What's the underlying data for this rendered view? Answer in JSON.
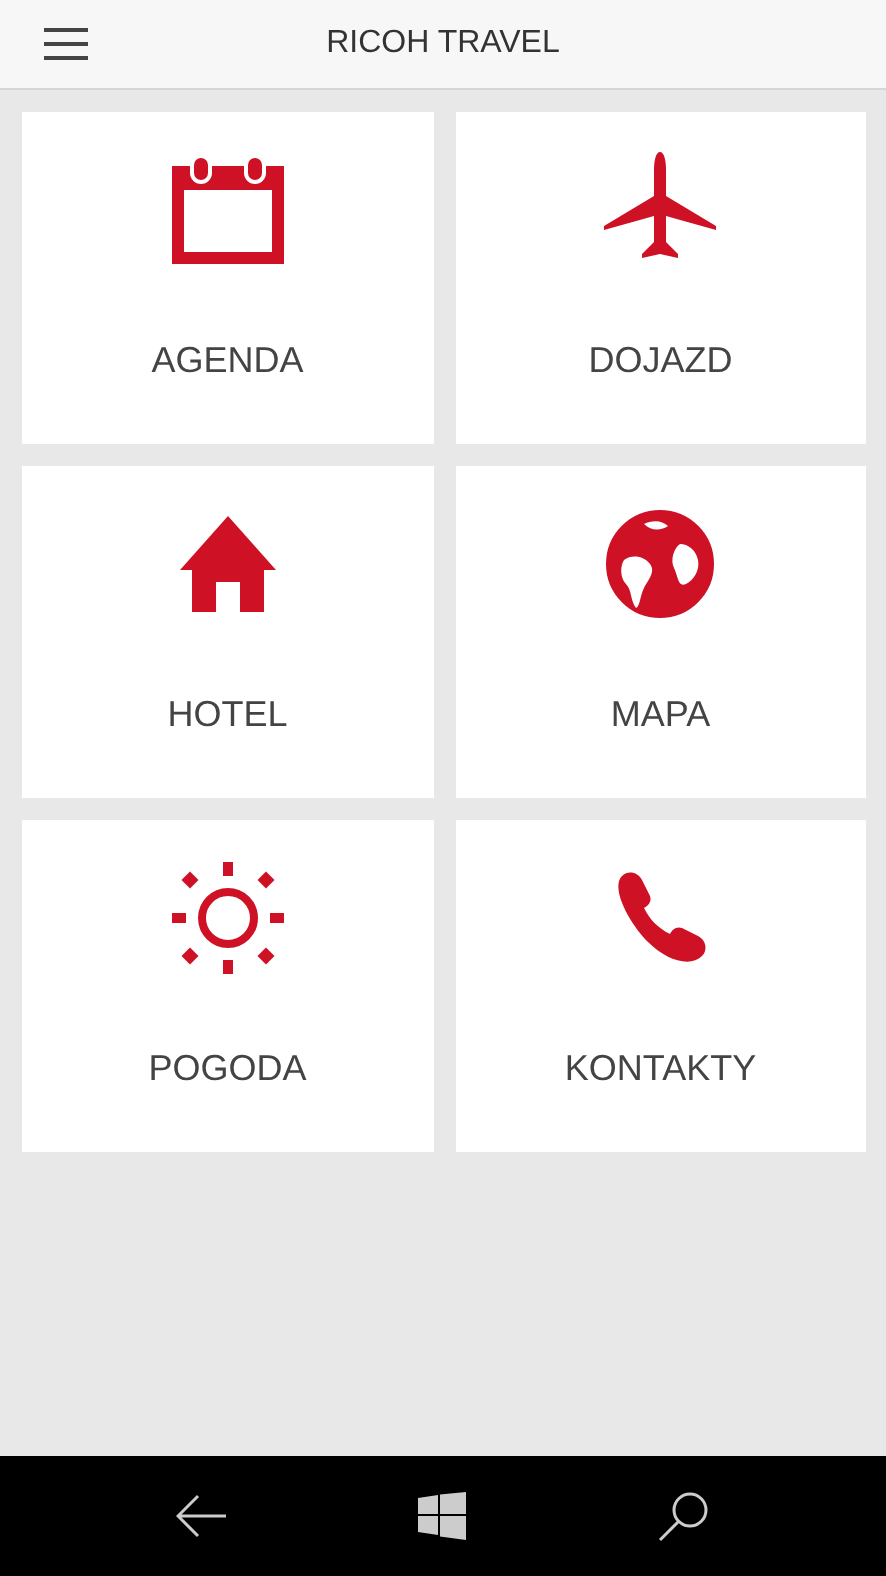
{
  "header": {
    "title": "RICOH TRAVEL"
  },
  "tiles": [
    {
      "label": "AGENDA"
    },
    {
      "label": "DOJAZD"
    },
    {
      "label": "HOTEL"
    },
    {
      "label": "MAPA"
    },
    {
      "label": "POGODA"
    },
    {
      "label": "KONTAKTY"
    }
  ]
}
